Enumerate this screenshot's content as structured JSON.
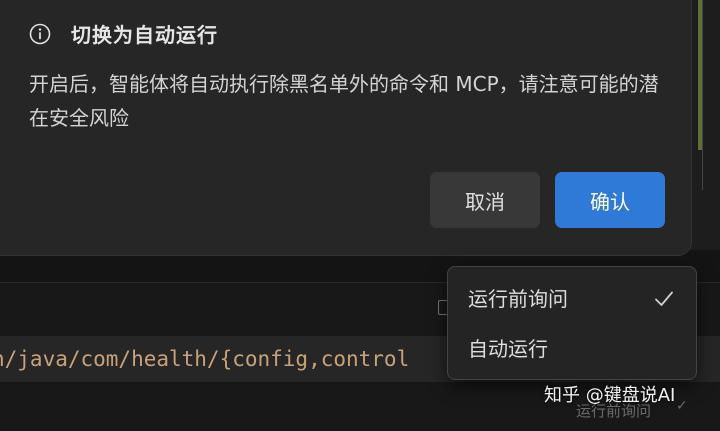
{
  "dialog": {
    "title": "切换为自动运行",
    "message": "开启后，智能体将自动执行除黑名单外的命令和 MCP，请注意可能的潜在安全风险",
    "cancel_label": "取消",
    "confirm_label": "确认",
    "icon": "info-icon"
  },
  "code": {
    "line": "n/java/com/health/{config,control"
  },
  "dropdown": {
    "items": [
      {
        "label": "运行前询问",
        "selected": true
      },
      {
        "label": "自动运行",
        "selected": false
      }
    ]
  },
  "status": {
    "mode_label": "运行前询问"
  },
  "watermark": {
    "text": "知乎 @键盘说AI"
  },
  "colors": {
    "accent": "#2f7ad6",
    "dialog_bg": "#262626",
    "code_text": "#c8a27a"
  }
}
